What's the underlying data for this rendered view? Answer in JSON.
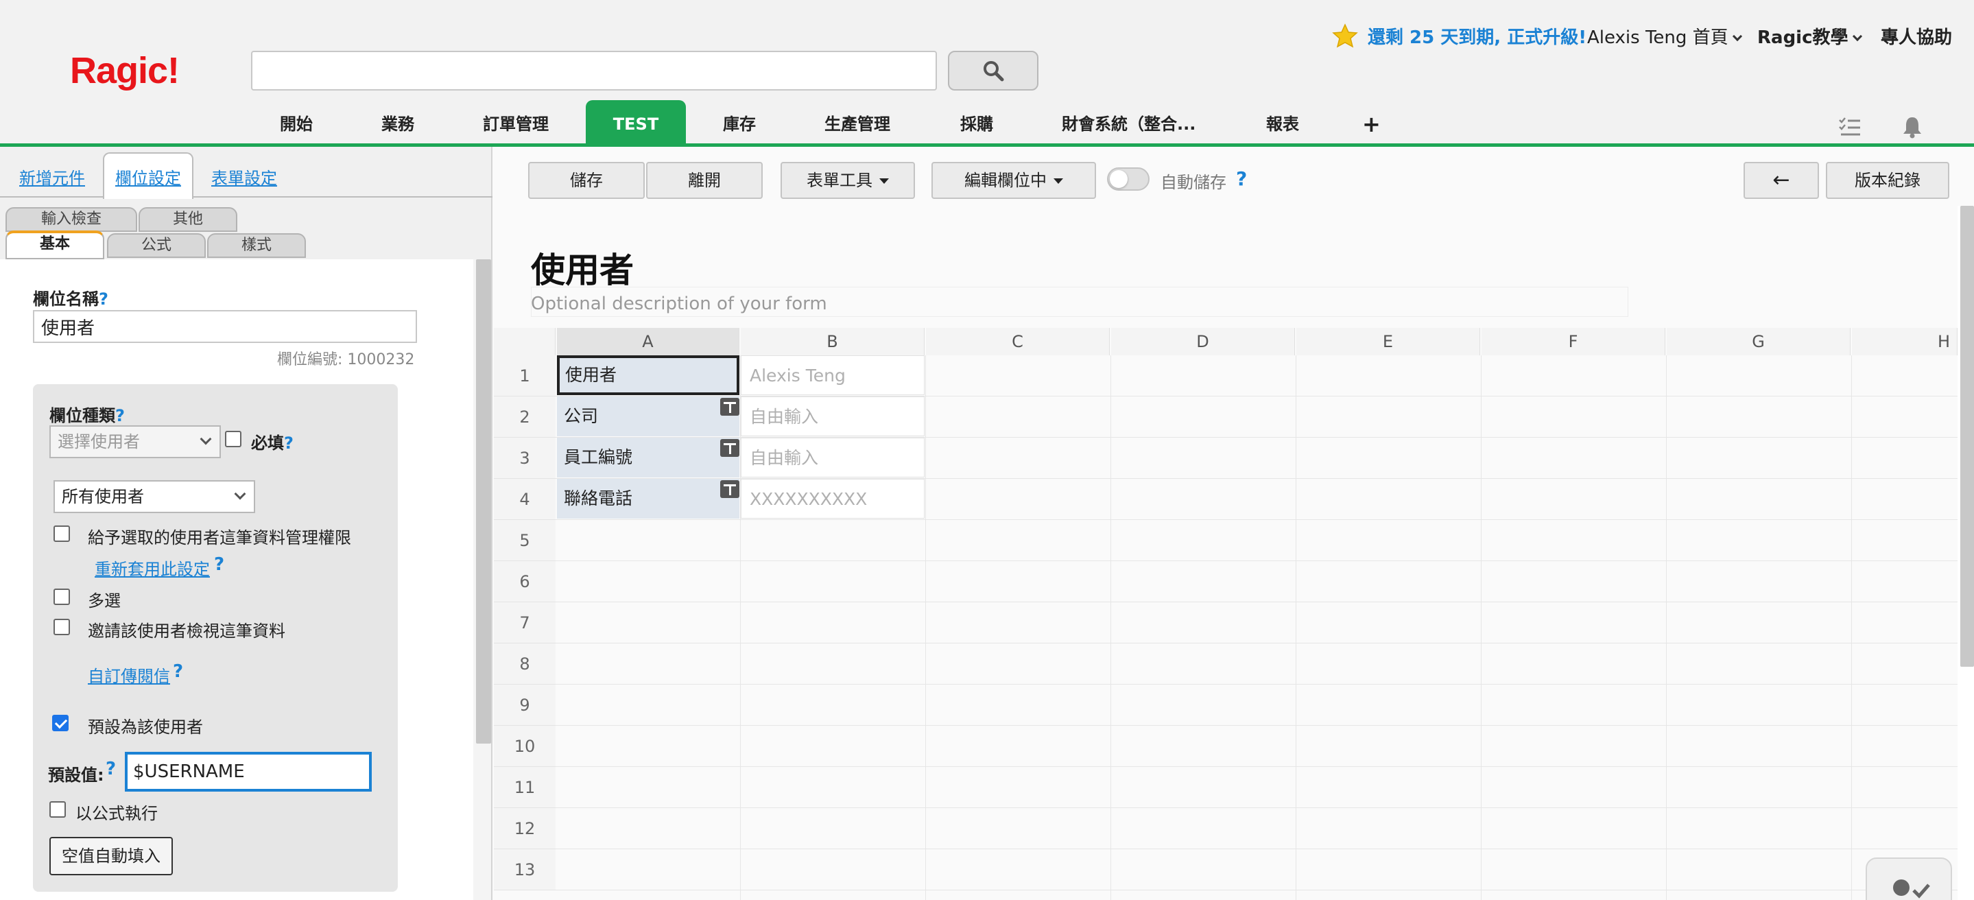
{
  "header": {
    "logo": "Ragic!",
    "search_placeholder": "",
    "upgrade_text": "還剩 25 天到期, 正式升級!",
    "user_home": "Alexis Teng 首頁",
    "tutorial": "Ragic教學",
    "expert_help": "專人協助",
    "nav_tabs": [
      "開始",
      "業務",
      "訂單管理",
      "TEST",
      "庫存",
      "生產管理",
      "採購",
      "財會系統（整合...",
      "報表",
      "+"
    ],
    "active_tab": "TEST",
    "accent_color": "#1da655",
    "logo_color": "#e8161b"
  },
  "left_panel": {
    "tabs": [
      "新增元件",
      "欄位設定",
      "表單設定"
    ],
    "active_tab": "欄位設定",
    "sub_tabs_top": [
      "輸入檢查",
      "其他"
    ],
    "sub_tabs_bottom": [
      "基本",
      "公式",
      "樣式"
    ],
    "active_sub_tab": "基本",
    "field_name_label": "欄位名稱",
    "field_name_value": "使用者",
    "field_number": "欄位編號: 1000232",
    "field_type_label": "欄位種類",
    "field_type_value": "選擇使用者",
    "required_label": "必填",
    "user_scope_value": "所有使用者",
    "grant_permission_label": "給予選取的使用者這筆資料管理權限",
    "reapply_link": "重新套用此設定",
    "multi_select_label": "多選",
    "invite_view_label": "邀請該使用者檢視這筆資料",
    "custom_message_link": "自訂傳閱信",
    "default_user_label": "預設為該使用者",
    "default_user_checked": true,
    "default_value_label": "預設值:",
    "default_value": "$USERNAME",
    "formula_exec_label": "以公式執行",
    "auto_fill_button": "空值自動填入",
    "help_mark": "?"
  },
  "toolbar": {
    "save": "儲存",
    "leave": "離開",
    "form_tools": "表單工具",
    "edit_fields": "編輯欄位中",
    "autosave": "自動儲存",
    "back_arrow": "←",
    "version_history": "版本紀錄"
  },
  "form": {
    "title": "使用者",
    "description": "Optional description of your form",
    "columns": [
      "A",
      "B",
      "C",
      "D",
      "E",
      "F",
      "G",
      "H"
    ],
    "rows": [
      "1",
      "2",
      "3",
      "4",
      "5",
      "6",
      "7",
      "8",
      "9",
      "10",
      "11",
      "12",
      "13"
    ],
    "fields": [
      {
        "label": "使用者",
        "placeholder": "Alexis Teng"
      },
      {
        "label": "公司",
        "placeholder": "自由輸入"
      },
      {
        "label": "員工編號",
        "placeholder": "自由輸入"
      },
      {
        "label": "聯絡電話",
        "placeholder": "XXXXXXXXXX"
      }
    ]
  }
}
